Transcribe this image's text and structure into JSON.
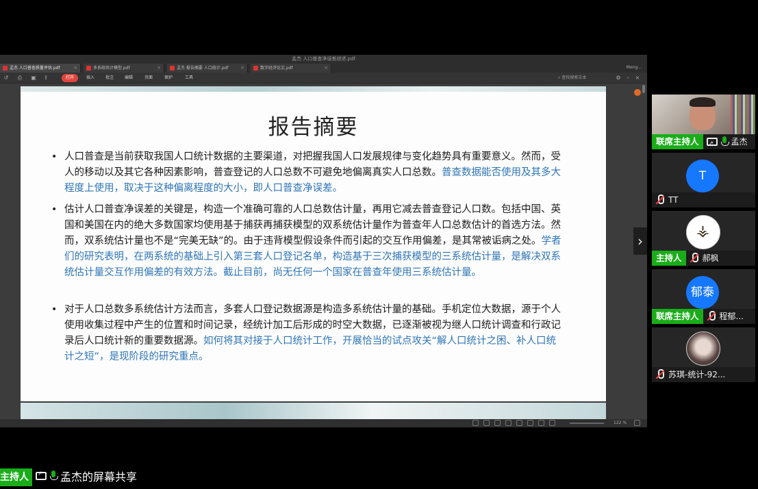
{
  "window": {
    "title": "孟杰 人口普查净误差综述.pdf",
    "user": "Meng..."
  },
  "tabs": [
    {
      "label": "孟杰 人口普查质量评估.pdf"
    },
    {
      "label": "多系统估计模型.pdf"
    },
    {
      "label": "孟杰 报告摘要 人口统计.pdf"
    },
    {
      "label": "数字经济论文.pdf"
    }
  ],
  "toolbar": {
    "open_label": "打开",
    "menus": [
      "插入",
      "批注",
      "编辑",
      "页面",
      "保护",
      "工具"
    ],
    "search_placeholder": "查找搜索文本"
  },
  "slide": {
    "title": "报告摘要",
    "bullets": [
      {
        "black": "人口普查是当前获取我国人口统计数据的主要渠道，对把握我国人口发展规律与变化趋势具有重要意义。然而，受人的移动以及其它各种因素影响，普查登记的人口总数不可避免地偏离真实人口总数。",
        "blue": "普查数据能否使用及其多大程度上使用，取决于这种偏离程度的大小，即人口普查净误差。"
      },
      {
        "black": "估计人口普查净误差的关键是，构造一个准确可靠的人口总数估计量，再用它减去普查登记人口数。包括中国、英国和美国在内的绝大多数国家均使用基于捕获再捕获模型的双系统估计量作为普查年人口总数估计的首选方法。然而，双系统估计量也不是“完美无缺”的。由于违背模型假设条件而引起的交互作用偏差，是其常被诟病之处。",
        "blue": "学者们的研究表明，在两系统的基础上引入第三套人口登记名单，构造基于三次捕获模型的三系统估计量，是解决双系统估计量交互作用偏差的有效方法。截止目前，尚无任何一个国家在普查年使用三系统估计量。"
      },
      {
        "black": "对于人口总数多系统估计方法而言，多套人口登记数据源是构造多系统估计量的基础。手机定位大数据，源于个人使用收集过程中产生的位置和时间记录，经统计加工后形成的时空大数据，已逐渐被视为继人口统计调查和行政记录后人口统计新的重要数据源。",
        "blue": "如何将其对接于人口统计工作，开展恰当的试点攻关“解人口统计之困、补人口统计之短”，是现阶段的研究重点。"
      }
    ]
  },
  "status_bar": {
    "zoom": "122 %"
  },
  "participants": [
    {
      "role": "联席主持人",
      "name": "孟杰",
      "mic": "on",
      "sharing": true,
      "avatar_type": "video"
    },
    {
      "role": "",
      "name": "TT",
      "mic": "off",
      "sharing": false,
      "avatar_type": "letter",
      "avatar_text": "T"
    },
    {
      "role": "主持人",
      "name": "郝枫",
      "mic": "off",
      "sharing": false,
      "avatar_type": "image"
    },
    {
      "role": "联席主持人",
      "name": "程郁...",
      "mic": "off",
      "sharing": false,
      "avatar_type": "letter",
      "avatar_text": "郁泰"
    },
    {
      "role": "",
      "name": "苏琪-统计-92...",
      "mic": "off",
      "sharing": false,
      "avatar_type": "photo"
    }
  ],
  "bottom_bar": {
    "host_label": "主持人",
    "share_text": "孟杰的屏幕共享"
  },
  "colors": {
    "host_green": "#1aad19",
    "avatar_blue": "#1677ff",
    "slide_blue_text": "#2e75b6",
    "pdf_open_red": "#e0463d"
  }
}
